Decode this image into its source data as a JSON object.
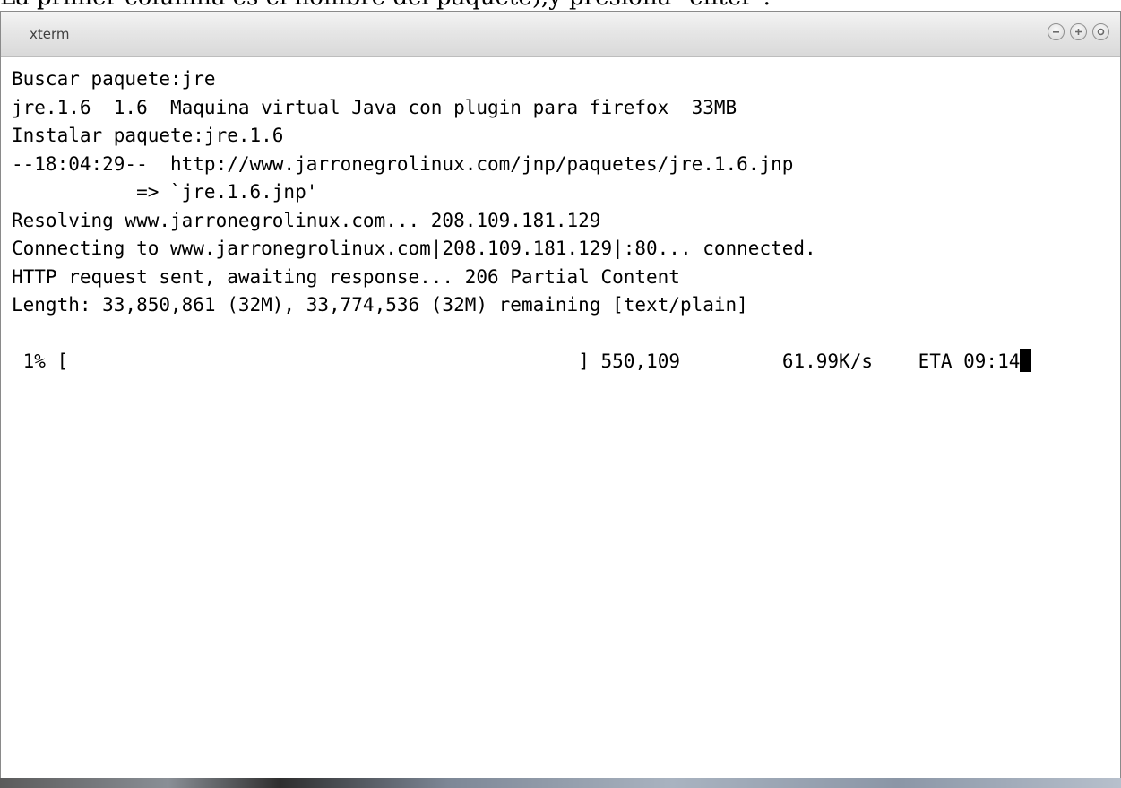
{
  "caption": {
    "text": "La primer columna es el nombre del paquete),y presiona \"enter\"."
  },
  "window": {
    "title": "xterm",
    "controls": [
      "minimize-icon",
      "maximize-icon",
      "close-icon"
    ]
  },
  "terminal": {
    "lines": [
      "Buscar paquete:jre",
      "jre.1.6  1.6  Maquina virtual Java con plugin para firefox  33MB",
      "Instalar paquete:jre.1.6",
      "--18:04:29--  http://www.jarronegrolinux.com/jnp/paquetes/jre.1.6.jnp",
      "           => `jre.1.6.jnp'",
      "Resolving www.jarronegrolinux.com... 208.109.181.129",
      "Connecting to www.jarronegrolinux.com|208.109.181.129|:80... connected.",
      "HTTP request sent, awaiting response... 206 Partial Content",
      "Length: 33,850,861 (32M), 33,774,536 (32M) remaining [text/plain]",
      ""
    ],
    "progress": {
      "percent": "1%",
      "bar_open": "[",
      "bar_close": "]",
      "bytes": "550,109",
      "speed": "61.99K/s",
      "eta": "ETA 09:14"
    }
  }
}
